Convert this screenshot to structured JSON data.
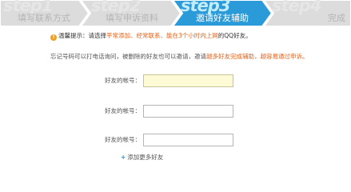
{
  "steps": [
    {
      "step": "step1",
      "title": "填写联系方式",
      "state": "inactive"
    },
    {
      "step": "step2",
      "title": "填写申诉资料",
      "state": "inactive"
    },
    {
      "step": "step3",
      "title": "邀请好友辅助",
      "state": "active"
    },
    {
      "step": "step4",
      "title": "完成",
      "state": "inactive"
    }
  ],
  "tip": {
    "icon": "!",
    "prefix": "温馨提示：请选择",
    "highlight1": "平常添加、经常联系、能在3个小时内上网",
    "suffix": "的QQ好友。"
  },
  "desc": {
    "text": "忘记号码可以打电话询问，被删除的好友也可以邀请，邀请",
    "highlight": "越多好友完成辅助，越容易通过申诉。"
  },
  "fields": [
    {
      "label": "好友的帐号：",
      "value": "",
      "focused": true
    },
    {
      "label": "好友的帐号：",
      "value": "",
      "focused": false
    },
    {
      "label": "好友的帐号：",
      "value": "",
      "focused": false
    }
  ],
  "add_more": {
    "icon": "+",
    "label": "添加更多好友"
  },
  "colors": {
    "active": "#2a9ad8",
    "inactive": "#dcdcdc",
    "highlight": "#e0621b",
    "input_focus_bg": "#fdfbd6"
  }
}
